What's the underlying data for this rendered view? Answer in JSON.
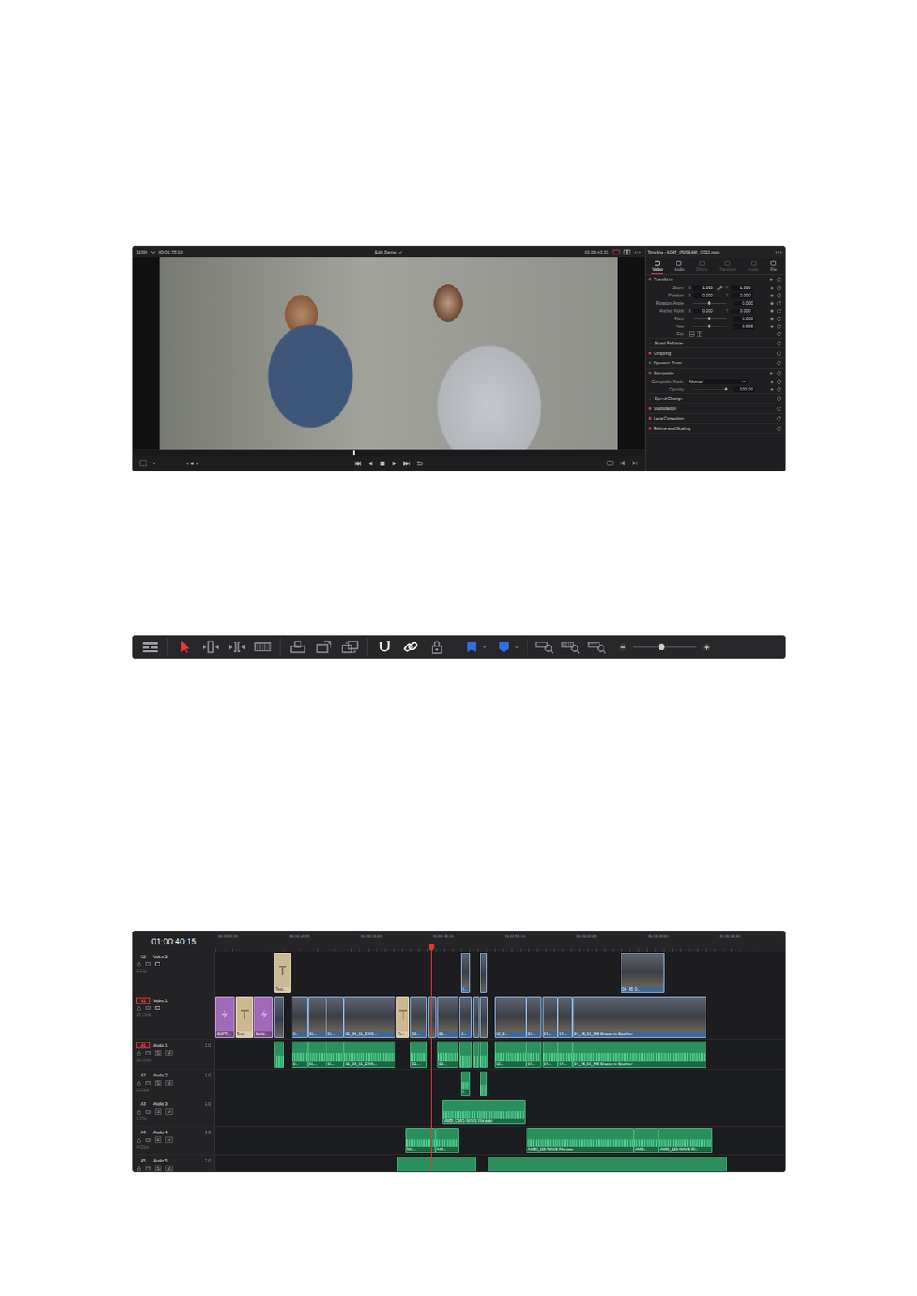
{
  "viewer": {
    "zoom": "119%",
    "source_timecode": "00:01:35:10",
    "timeline_name": "Edit Demo",
    "record_timecode": "01:00:41:01",
    "scrub_level": 0.43
  },
  "inspector": {
    "title": "Timeline - A045_05091446_C010.mov",
    "tabs": [
      {
        "label": "Video",
        "selected": true,
        "disabled": false
      },
      {
        "label": "Audio",
        "selected": false,
        "disabled": false
      },
      {
        "label": "Effects",
        "selected": false,
        "disabled": true
      },
      {
        "label": "Transition",
        "selected": false,
        "disabled": true
      },
      {
        "label": "Image",
        "selected": false,
        "disabled": true
      },
      {
        "label": "File",
        "selected": false,
        "disabled": false
      }
    ],
    "sections": [
      {
        "title": "Transform",
        "kind": "toggle",
        "enabled": true,
        "params": [
          {
            "label": "Zoom",
            "kind": "xy",
            "x_label": "X",
            "x": "1.000",
            "y_label": "Y",
            "y": "1.000",
            "linked": true
          },
          {
            "label": "Position",
            "kind": "xy",
            "x_label": "X",
            "x": "0.000",
            "y_label": "Y",
            "y": "0.000",
            "linked": false
          },
          {
            "label": "Rotation Angle",
            "kind": "slider",
            "value": "0.000",
            "level": 0.5
          },
          {
            "label": "Anchor Point",
            "kind": "xy",
            "x_label": "X",
            "x": "0.000",
            "y_label": "Y",
            "y": "0.000",
            "linked": false
          },
          {
            "label": "Pitch",
            "kind": "slider",
            "value": "0.000",
            "level": 0.5
          },
          {
            "label": "Yaw",
            "kind": "slider",
            "value": "0.000",
            "level": 0.5
          },
          {
            "label": "Flip",
            "kind": "flip"
          }
        ]
      },
      {
        "title": "Smart Reframe",
        "kind": "plain",
        "enabled": false,
        "params": []
      },
      {
        "title": "Cropping",
        "kind": "toggle",
        "enabled": true,
        "params": []
      },
      {
        "title": "Dynamic Zoom",
        "kind": "toggle",
        "enabled": false,
        "params": []
      },
      {
        "title": "Composite",
        "kind": "toggle",
        "enabled": true,
        "params": [
          {
            "label": "Composite Mode",
            "kind": "select",
            "value": "Normal"
          },
          {
            "label": "Opacity",
            "kind": "slider",
            "value": "100.00",
            "level": 1
          }
        ]
      },
      {
        "title": "Speed Change",
        "kind": "plain",
        "enabled": false,
        "params": []
      },
      {
        "title": "Stabilization",
        "kind": "toggle",
        "enabled": true,
        "params": []
      },
      {
        "title": "Lens Correction",
        "kind": "toggle",
        "enabled": true,
        "params": []
      },
      {
        "title": "Retime and Scaling",
        "kind": "toggle",
        "enabled": true,
        "params": []
      }
    ]
  },
  "toolbar": {
    "groups": [
      [
        {
          "kind": "view",
          "selected": false
        }
      ],
      [
        {
          "kind": "select",
          "selected": true
        },
        {
          "kind": "trim",
          "selected": false
        },
        {
          "kind": "dynamic",
          "selected": false
        },
        {
          "kind": "blade",
          "selected": false
        }
      ],
      [
        {
          "kind": "insert",
          "selected": false
        },
        {
          "kind": "overwrite",
          "selected": false
        },
        {
          "kind": "replace",
          "selected": false
        }
      ],
      [
        {
          "kind": "snap",
          "selected": true
        },
        {
          "kind": "link",
          "selected": true
        },
        {
          "kind": "lock",
          "selected": false
        }
      ],
      [
        {
          "kind": "flag",
          "selected": false
        },
        {
          "kind": "marker",
          "selected": false
        }
      ],
      [
        {
          "kind": "zoomfull",
          "selected": false
        },
        {
          "kind": "zoomdetail",
          "selected": false
        },
        {
          "kind": "zoomcustom",
          "selected": false
        }
      ]
    ],
    "zoom": {
      "level": 0.45
    }
  },
  "timeline": {
    "timecode": "01:00:40:15",
    "ruler": [
      "01:00:00:00",
      "01:00:10:09",
      "01:00:21:13",
      "01:00:40:01",
      "01:00:50:14",
      "01:01:10:23",
      "01:01:20:09",
      "01:01:52:10"
    ],
    "tracks": [
      {
        "id": "V2",
        "name": "Video 2",
        "kind": "video",
        "count": "1 Clip",
        "selected": false,
        "clips": [
          {
            "kind": "title",
            "label": "Text..."
          },
          {
            "kind": "video",
            "label": "0..."
          },
          {
            "kind": "video"
          },
          {
            "kind": "video",
            "label": "04_45_0..."
          }
        ]
      },
      {
        "id": "V1",
        "name": "Video 1",
        "kind": "video",
        "count": "25 Clips",
        "selected": true,
        "clips": [
          {
            "kind": "generator",
            "label": "SMPT..."
          },
          {
            "kind": "title",
            "label": "Text"
          },
          {
            "kind": "generator",
            "label": "Solid..."
          },
          {
            "kind": "video"
          },
          {
            "kind": "video",
            "label": "0..."
          },
          {
            "kind": "video",
            "label": "01..."
          },
          {
            "kind": "video",
            "label": "01..."
          },
          {
            "kind": "video",
            "label": "01_06_01_EWS..."
          },
          {
            "kind": "title",
            "label": "Te..."
          },
          {
            "kind": "video",
            "label": "02..."
          },
          {
            "kind": "video"
          },
          {
            "kind": "video",
            "label": "01..."
          },
          {
            "kind": "video",
            "label": "0..."
          },
          {
            "kind": "video"
          },
          {
            "kind": "video"
          },
          {
            "kind": "video",
            "label": "02_3..."
          },
          {
            "kind": "video",
            "label": "04..."
          },
          {
            "kind": "video",
            "label": "04..."
          },
          {
            "kind": "video",
            "label": "04..."
          },
          {
            "kind": "video",
            "label": "04_45_01_MS Sharon to Sparkler"
          }
        ]
      },
      {
        "id": "A1",
        "name": "Audio 1",
        "kind": "audio",
        "channels": "1.0",
        "count": "25 Clips",
        "solo": "S",
        "mute": "M",
        "selected": true,
        "clips": [
          {
            "kind": "audio"
          },
          {
            "kind": "audio",
            "label": "0..."
          },
          {
            "kind": "audio",
            "label": "01..."
          },
          {
            "kind": "audio",
            "label": "01..."
          },
          {
            "kind": "audio",
            "label": "01_06_01_EWS..."
          },
          {
            "kind": "audio",
            "label": "02..."
          },
          {
            "kind": "audio",
            "label": "02..."
          },
          {
            "kind": "audio"
          },
          {
            "kind": "audio"
          },
          {
            "kind": "audio"
          },
          {
            "kind": "audio",
            "label": "02..."
          },
          {
            "kind": "audio",
            "label": "04..."
          },
          {
            "kind": "audio",
            "label": "04..."
          },
          {
            "kind": "audio",
            "label": "04..."
          },
          {
            "kind": "audio",
            "label": "04_45_01_MS Sharon to Sparkler"
          }
        ]
      },
      {
        "id": "A2",
        "name": "Audio 2",
        "kind": "audio",
        "channels": "1.0",
        "count": "2 Clips",
        "solo": "S",
        "mute": "M",
        "selected": false,
        "clips": [
          {
            "kind": "audio",
            "label": "0..."
          },
          {
            "kind": "audio"
          }
        ]
      },
      {
        "id": "A3",
        "name": "Audio 3",
        "kind": "audio",
        "channels": "1.0",
        "count": "1 Clip",
        "solo": "S",
        "mute": "M",
        "selected": false,
        "clips": [
          {
            "kind": "audio",
            "label": "AMBI_OWS-WAVE File.wav"
          }
        ]
      },
      {
        "id": "A4",
        "name": "Audio 4",
        "kind": "audio",
        "channels": "1.0",
        "count": "4 Clips",
        "solo": "S",
        "mute": "M",
        "selected": false,
        "clips": [
          {
            "kind": "audio",
            "label": "AM..."
          },
          {
            "kind": "audio",
            "label": "AM..."
          },
          {
            "kind": "audio",
            "label": "AMBI_115-WAVE File.wav"
          },
          {
            "kind": "audio",
            "label": "AMB..."
          },
          {
            "kind": "audio",
            "label": "AMBI_115-WAVE Fil..."
          }
        ]
      },
      {
        "id": "A5",
        "name": "Audio 5",
        "kind": "audio",
        "channels": "2.0",
        "solo": "S",
        "mute": "M",
        "selected": false,
        "clips": [
          {
            "kind": "audio"
          },
          {
            "kind": "audio"
          }
        ]
      }
    ]
  }
}
